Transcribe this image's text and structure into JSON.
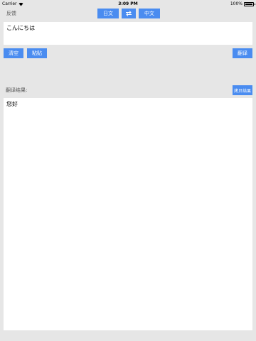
{
  "status_bar": {
    "carrier": "Carrier",
    "time": "3:09 PM",
    "battery": "100%"
  },
  "top_bar": {
    "feedback": "反馈",
    "source_lang": "日文",
    "target_lang": "中文",
    "swap_icon": "swap-arrows-icon"
  },
  "source": {
    "text": "こんにちは"
  },
  "actions": {
    "clear": "清空",
    "paste": "粘贴",
    "translate": "翻译"
  },
  "result": {
    "label": "翻译结果:",
    "copy": "拷贝结果",
    "text": "您好"
  },
  "colors": {
    "accent": "#4a8cf0",
    "background": "#e6e6e6"
  }
}
